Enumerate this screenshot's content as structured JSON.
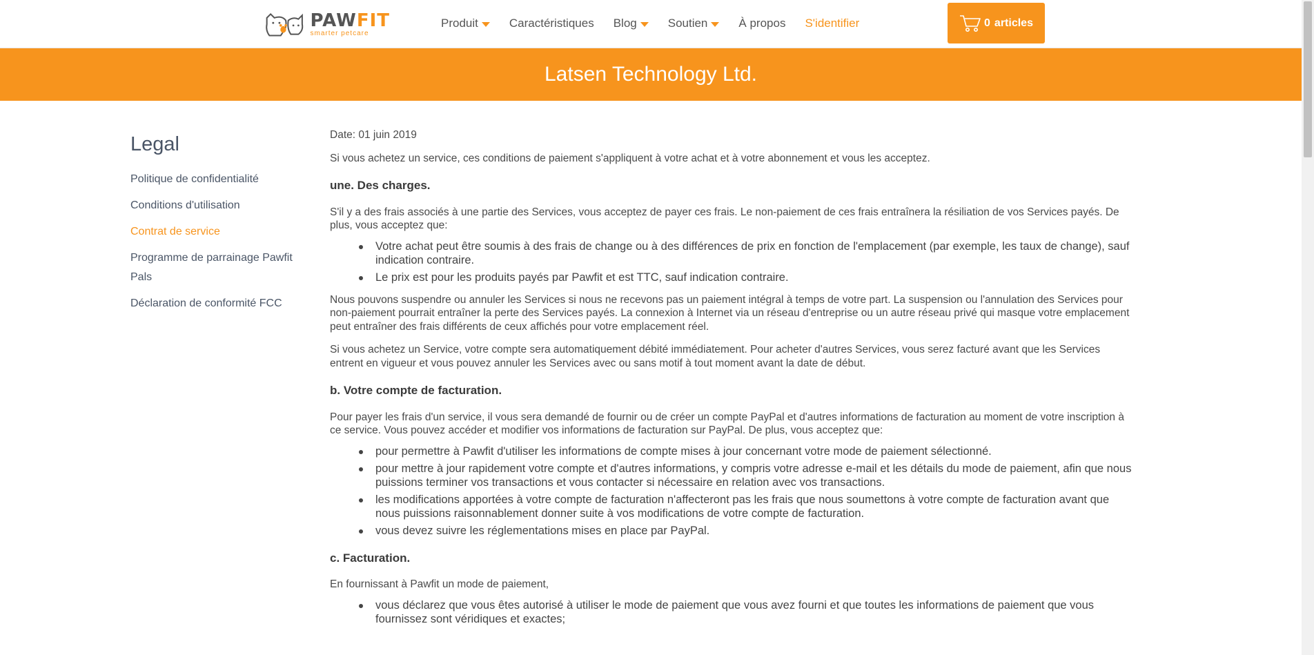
{
  "header": {
    "logo_word_prefix": "PAW",
    "logo_word_suffix": "FIT",
    "logo_tagline": "smarter petcare",
    "nav": [
      {
        "label": "Produit",
        "has_caret": true
      },
      {
        "label": "Caractéristiques",
        "has_caret": false
      },
      {
        "label": "Blog",
        "has_caret": true
      },
      {
        "label": "Soutien",
        "has_caret": true
      },
      {
        "label": "À propos",
        "has_caret": false
      },
      {
        "label": "S'identifier",
        "has_caret": false
      }
    ],
    "cart": {
      "count": "0",
      "label": "articles",
      "icon": "cart-icon"
    }
  },
  "banner": {
    "title": "Latsen Technology Ltd."
  },
  "sidebar": {
    "title": "Legal",
    "links": [
      {
        "label": "Politique de confidentialité"
      },
      {
        "label": "Conditions d'utilisation"
      },
      {
        "label": "Contrat de service"
      },
      {
        "label": "Programme de parrainage Pawfit Pals"
      },
      {
        "label": "Déclaration de conformité FCC"
      }
    ]
  },
  "content": {
    "date": "Date: 01 juin 2019",
    "intro": "Si vous achetez un service, ces conditions de paiement s'appliquent à votre achat et à votre abonnement et vous les acceptez.",
    "sec_a": {
      "heading": "une. Des charges.",
      "p1": "S'il y a des frais associés à une partie des Services, vous acceptez de payer ces frais. Le non-paiement de ces frais entraînera la résiliation de vos Services payés. De plus, vous acceptez que:",
      "items": [
        "Votre achat peut être soumis à des frais de change ou à des différences de prix en fonction de l'emplacement (par exemple, les taux de change), sauf indication contraire.",
        "Le prix est pour les produits payés par Pawfit et est TTC, sauf indication contraire."
      ],
      "p2": "Nous pouvons suspendre ou annuler les Services si nous ne recevons pas un paiement intégral à temps de votre part. La suspension ou l'annulation des Services pour non-paiement pourrait entraîner la perte des Services payés. La connexion à Internet via un réseau d'entreprise ou un autre réseau privé qui masque votre emplacement peut entraîner des frais différents de ceux affichés pour votre emplacement réel.",
      "p3": "Si vous achetez un Service, votre compte sera automatiquement débité immédiatement. Pour acheter d'autres Services, vous serez facturé avant que les Services entrent en vigueur et vous pouvez annuler les Services avec ou sans motif à tout moment avant la date de début."
    },
    "sec_b": {
      "heading": "b. Votre compte de facturation.",
      "p1": "Pour payer les frais d'un service, il vous sera demandé de fournir ou de créer un compte PayPal et d'autres informations de facturation au moment de votre inscription à ce service. Vous pouvez accéder et modifier vos informations de facturation sur PayPal. De plus, vous acceptez que:",
      "items": [
        "pour permettre à Pawfit d'utiliser les informations de compte mises à jour concernant votre mode de paiement sélectionné.",
        "pour mettre à jour rapidement votre compte et d'autres informations, y compris votre adresse e-mail et les détails du mode de paiement, afin que nous puissions terminer vos transactions et vous contacter si nécessaire en relation avec vos transactions.",
        "les modifications apportées à votre compte de facturation n'affecteront pas les frais que nous soumettons à votre compte de facturation avant que nous puissions raisonnablement donner suite à vos modifications de votre compte de facturation.",
        "vous devez suivre les réglementations mises en place par PayPal."
      ]
    },
    "sec_c": {
      "heading": "c. Facturation.",
      "p1": "En fournissant à Pawfit un mode de paiement,",
      "items": [
        "vous déclarez que vous êtes autorisé à utiliser le mode de paiement que vous avez fourni et que toutes les informations de paiement que vous fournissez sont véridiques et exactes;"
      ]
    }
  },
  "colors": {
    "accent": "#f7941d",
    "text": "#4a4a4a",
    "sidebar_text": "#4a5566"
  }
}
